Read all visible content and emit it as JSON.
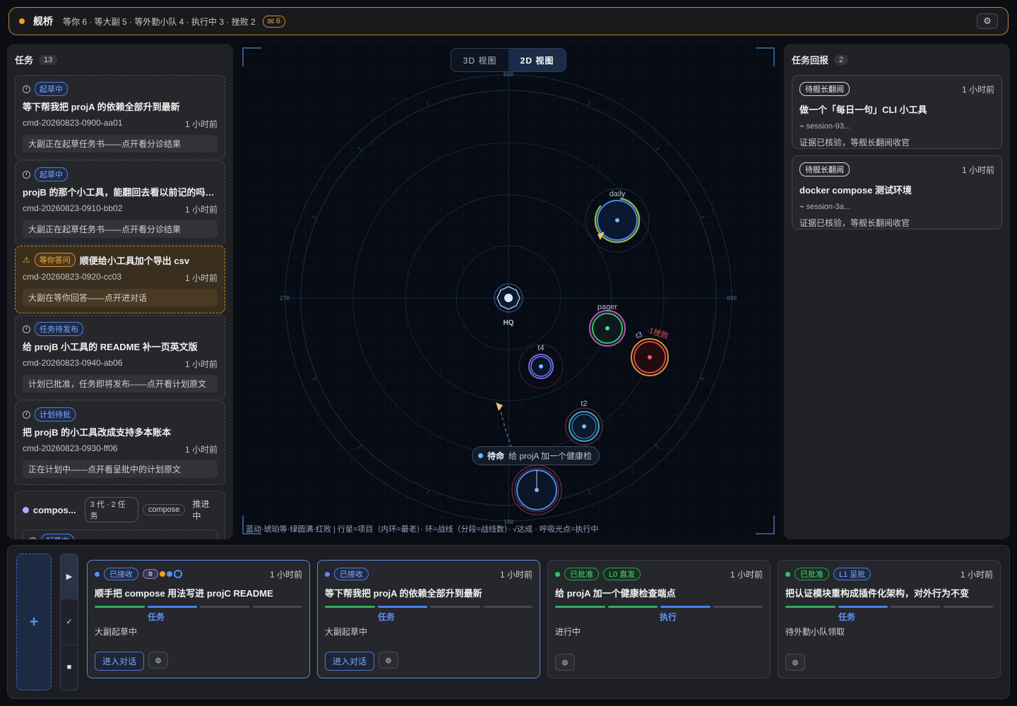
{
  "topbar": {
    "title": "舰桥",
    "stats": "等你 6 · 等大副 5 · 等外勤小队 4 · 执行中 3 · 挫败 2",
    "mail_icon": "mail-icon",
    "mail_count": "6",
    "settings_icon": "⚙"
  },
  "tasks_panel": {
    "title": "任务",
    "count": "13",
    "cards": [
      {
        "status": "起草中",
        "title": "等下帮我把 projA 的依赖全部升到最新",
        "id": "cmd-20260823-0900-aa01",
        "time": "1 小时前",
        "note": "大副正在起草任务书——点开看分诊结果"
      },
      {
        "status": "起草中",
        "title": "projB 的那个小工具，能翻回去看以前记的吗…",
        "id": "cmd-20260823-0910-bb02",
        "time": "1 小时前",
        "note": "大副正在起草任务书——点开看分诊结果"
      },
      {
        "status": "等你答问",
        "title": "顺便给小工具加个导出 csv",
        "id": "cmd-20260823-0920-cc03",
        "time": "1 小时前",
        "note": "大副在等你回答——点开进对话"
      },
      {
        "status": "任务待发布",
        "title": "给 projB 小工具的 README 补一页英文版",
        "id": "cmd-20260823-0940-ab06",
        "time": "1 小时前",
        "note": "计划已批准，任务即将发布——点开看计划原文"
      },
      {
        "status": "计划待批",
        "title": "把 projB 的小工具改成支持多本账本",
        "id": "cmd-20260823-0930-ff06",
        "time": "1 小时前",
        "note": "正在计划中——点开看呈批中的计划原文"
      }
    ],
    "group": {
      "name": "compos...",
      "gen": "3 代 · 2 任务",
      "tag": "compose",
      "status": "推进中",
      "sub_status": "起草中"
    }
  },
  "map": {
    "view_3d": "3D 视图",
    "view_2d": "2D 视图",
    "hq_label": "HQ",
    "bearing_000": "000",
    "bearing_090": "090",
    "bearing_180": "180",
    "bearing_270": "270",
    "planet_daily": "daily",
    "planet_pager": "pager",
    "planet_t3": "t3",
    "planet_t3_fail": "·1挫败",
    "planet_t4": "t4",
    "planet_t2": "t2",
    "mission_label": "待命",
    "mission_text": "给 projA 加一个健康检",
    "legend": "蓝动·琥珀等·绿圆满·红败  |  行星=项目（内环=最老）· 环=战线（分段=战线数）· √达成 · 呼吸光点=执行中"
  },
  "reports_panel": {
    "title": "任务回报",
    "count": "2",
    "cards": [
      {
        "badge": "待舰长翻阅",
        "time": "1 小时前",
        "title": "做一个「每日一句」CLI 小工具",
        "session": "⌁ session-93...",
        "note": "证据已核验，等舰长翻阅收官"
      },
      {
        "badge": "待舰长翻阅",
        "time": "1 小时前",
        "title": "docker compose 测试环境",
        "session": "⌁ session-3a...",
        "note": "证据已核验，等舰长翻阅收官"
      }
    ]
  },
  "dock": {
    "new_label": "+",
    "tabs": [
      "▶",
      "✓",
      "■"
    ],
    "cards": [
      {
        "pill1": "已接收",
        "pill2": "",
        "time": "1 小时前",
        "title": "顺手把 compose 用法写进 projC README",
        "stage": "任务",
        "desc": "大副起草中",
        "action": "进入对话",
        "icon": "⊚",
        "stages": [
          "done",
          "cur",
          "",
          ""
        ]
      },
      {
        "pill1": "已接收",
        "pill2": "",
        "time": "1 小时前",
        "title": "等下帮我把 projA 的依赖全部升到最新",
        "stage": "任务",
        "desc": "大副起草中",
        "action": "进入对话",
        "icon": "⊚",
        "stages": [
          "done",
          "cur",
          "",
          ""
        ]
      },
      {
        "pill1": "已批准",
        "pill2": "L0 直发",
        "time": "1 小时前",
        "title": "给 projA 加一个健康检查端点",
        "stage": "执行",
        "desc": "进行中",
        "action": "",
        "icon": "⊚",
        "stages": [
          "done",
          "done",
          "cur",
          ""
        ]
      },
      {
        "pill1": "已批准",
        "pill2": "L1 呈批",
        "time": "1 小时前",
        "title": "把认证模块重构成插件化架构，对外行为不变",
        "stage": "任务",
        "desc": "待外勤小队领取",
        "action": "",
        "icon": "⊚",
        "stages": [
          "done",
          "cur",
          "",
          ""
        ]
      }
    ],
    "glyph_label": "Ⅲ"
  },
  "colors": {
    "accent": "#5b8cff",
    "warn": "#f0a020",
    "ok": "#34c26a",
    "fail": "#e0453a"
  }
}
